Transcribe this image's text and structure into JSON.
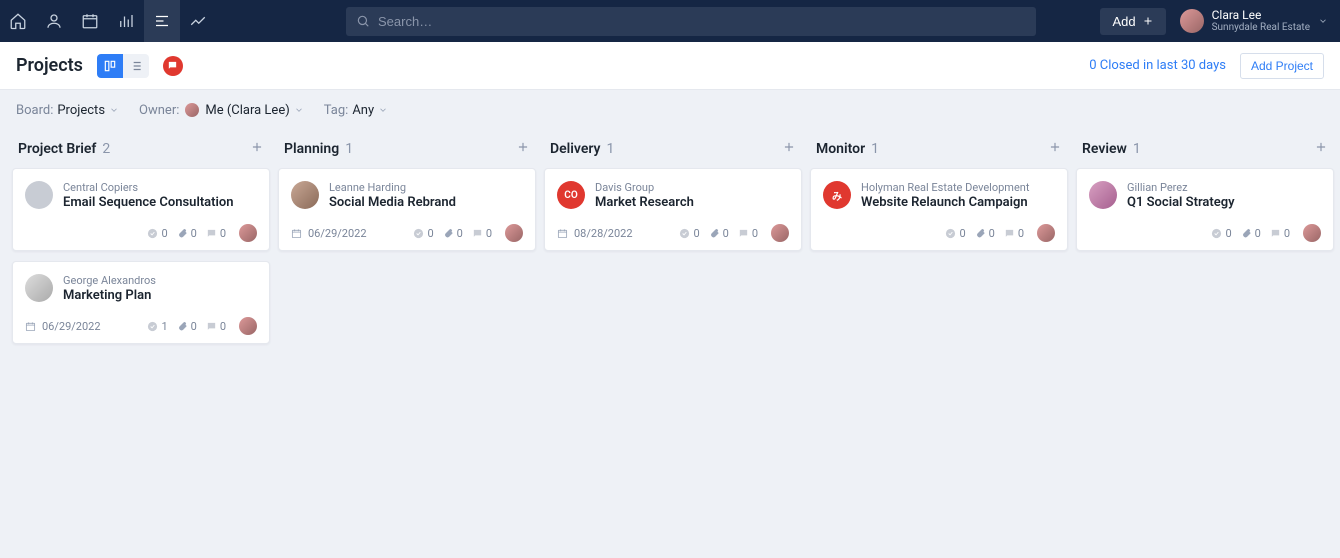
{
  "topnav": {
    "search_placeholder": "Search…",
    "add_label": "Add"
  },
  "user": {
    "name": "Clara Lee",
    "org": "Sunnydale Real Estate"
  },
  "page": {
    "title": "Projects",
    "closed_text": "0 Closed in last 30 days",
    "add_project_label": "Add Project"
  },
  "filters": {
    "board": {
      "label": "Board:",
      "value": "Projects"
    },
    "owner": {
      "label": "Owner:",
      "value": "Me (Clara Lee)"
    },
    "tag": {
      "label": "Tag:",
      "value": "Any"
    }
  },
  "columns": [
    {
      "name": "Project Brief",
      "count": "2",
      "cards": [
        {
          "client": "Central Copiers",
          "title": "Email Sequence Consultation",
          "date": "",
          "tasks": "0",
          "files": "0",
          "comments": "0",
          "avatarClass": "av-grey",
          "avatarText": ""
        },
        {
          "client": "George Alexandros",
          "title": "Marketing Plan",
          "date": "06/29/2022",
          "tasks": "1",
          "files": "0",
          "comments": "0",
          "avatarClass": "av-sketch",
          "avatarText": ""
        }
      ]
    },
    {
      "name": "Planning",
      "count": "1",
      "cards": [
        {
          "client": "Leanne Harding",
          "title": "Social Media Rebrand",
          "date": "06/29/2022",
          "tasks": "0",
          "files": "0",
          "comments": "0",
          "avatarClass": "av-photo",
          "avatarText": ""
        }
      ]
    },
    {
      "name": "Delivery",
      "count": "1",
      "cards": [
        {
          "client": "Davis Group",
          "title": "Market Research",
          "date": "08/28/2022",
          "tasks": "0",
          "files": "0",
          "comments": "0",
          "avatarClass": "av-red",
          "avatarText": "CO"
        }
      ]
    },
    {
      "name": "Monitor",
      "count": "1",
      "cards": [
        {
          "client": "Holyman Real Estate Development",
          "title": "Website Relaunch Campaign",
          "date": "",
          "tasks": "0",
          "files": "0",
          "comments": "0",
          "avatarClass": "av-red",
          "avatarText": "み"
        }
      ]
    },
    {
      "name": "Review",
      "count": "1",
      "cards": [
        {
          "client": "Gillian Perez",
          "title": "Q1 Social Strategy",
          "date": "",
          "tasks": "0",
          "files": "0",
          "comments": "0",
          "avatarClass": "av-pink",
          "avatarText": ""
        }
      ]
    }
  ]
}
